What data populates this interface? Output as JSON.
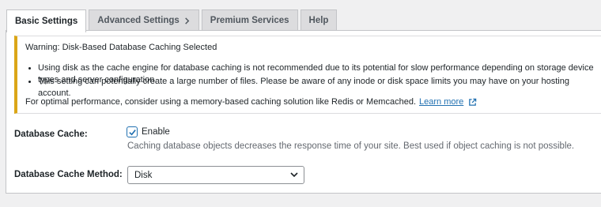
{
  "tabs": [
    {
      "label": "Basic Settings",
      "active": true
    },
    {
      "label": "Advanced Settings",
      "has_chevron": true
    },
    {
      "label": "Premium Services"
    },
    {
      "label": "Help"
    }
  ],
  "notice": {
    "title": "Warning: Disk-Based Database Caching Selected",
    "items": [
      "Using disk as the cache engine for database caching is not recommended due to its potential for slow performance depending on storage device types and server configuration.",
      "This setting can potentially create a large number of files. Please be aware of any inode or disk space limits you may have on your hosting account."
    ],
    "footer_text": "For optimal performance, consider using a memory-based caching solution like Redis or Memcached.",
    "link_text": "Learn more",
    "accent_color": "#dba617"
  },
  "database_cache": {
    "label": "Database Cache:",
    "checkbox_label": "Enable",
    "checked": true,
    "description": "Caching database objects decreases the response time of your site. Best used if object caching is not possible."
  },
  "database_cache_method": {
    "label": "Database Cache Method:",
    "selected": "Disk"
  },
  "colors": {
    "link": "#2271b1",
    "background": "#f0f0f1"
  }
}
